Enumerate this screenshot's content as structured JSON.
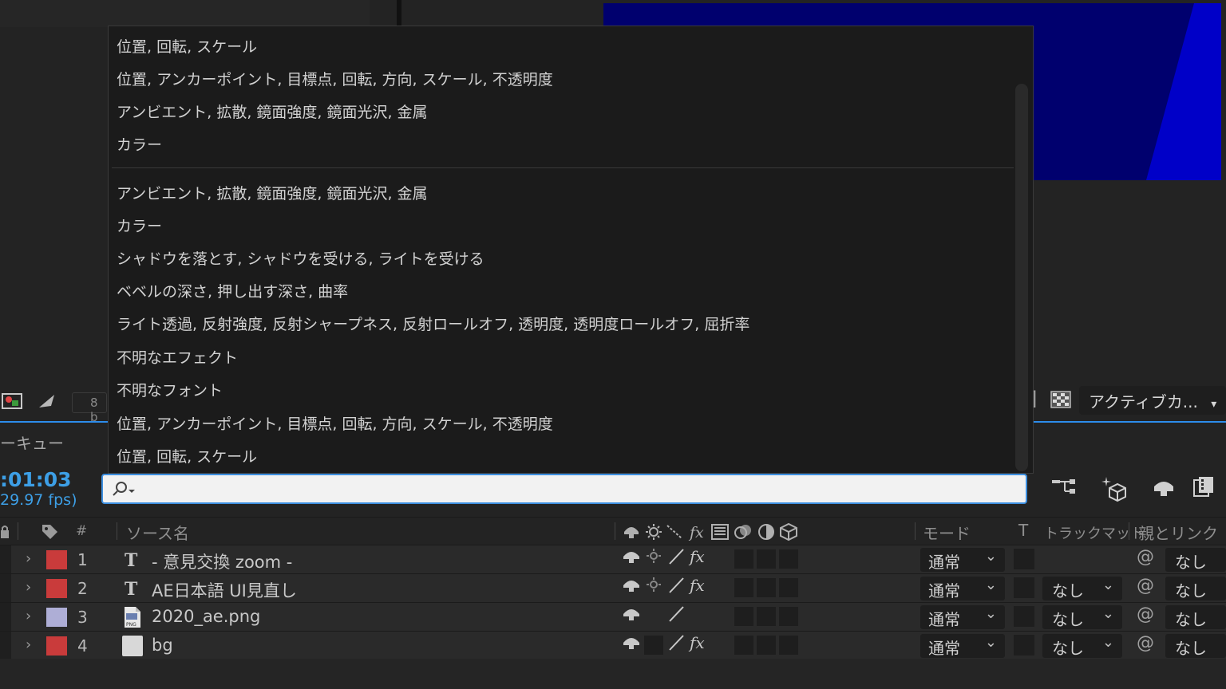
{
  "menu": {
    "items": [
      "位置, 回転, スケール",
      "位置, アンカーポイント, 目標点, 回転, 方向, スケール, 不透明度",
      "アンビエント, 拡散, 鏡面強度, 鏡面光沢, 金属",
      "カラー",
      "アンビエント, 拡散, 鏡面強度, 鏡面光沢, 金属",
      "カラー",
      "シャドウを落とす, シャドウを受ける, ライトを受ける",
      "ベベルの深さ, 押し出す深さ, 曲率",
      "ライト透過, 反射強度, 反射シャープネス, 反射ロールオフ, 透明度, 透明度ロールオフ, 屈折率",
      "不明なエフェクト",
      "不明なフォント",
      "位置, アンカーポイント, 目標点, 回転, 方向, スケール, 不透明度",
      "位置, 回転, スケール"
    ]
  },
  "viewer_toolbar": {
    "bit_depth": "8 b",
    "bracket": "]",
    "camera_label": "アクティブカ...",
    "camera_caret": "▾"
  },
  "timeline": {
    "tab_partial": "ーキュー",
    "timecode": ":01:03",
    "fps": "29.97 fps)",
    "search": {
      "value": "",
      "placeholder": ""
    },
    "headers": {
      "number": "#",
      "source_name": "ソース名",
      "mode": "モード",
      "t": "T",
      "track_matte": "トラックマット",
      "parent": "親とリンク"
    },
    "layers": [
      {
        "num": "1",
        "type": "text",
        "type_glyph": "T",
        "name": "- 意見交換 zoom -",
        "color": "#c93b3b",
        "mode": "通常",
        "matte": "",
        "parent": "なし",
        "has_fx": true,
        "has_quality": true
      },
      {
        "num": "2",
        "type": "text",
        "type_glyph": "T",
        "name": "AE日本語 UI見直し",
        "color": "#c93b3b",
        "mode": "通常",
        "matte": "なし",
        "parent": "なし",
        "has_fx": true,
        "has_quality": true
      },
      {
        "num": "3",
        "type": "png",
        "type_glyph": "PNG",
        "name": "2020_ae.png",
        "color": "#aeaed6",
        "mode": "通常",
        "matte": "なし",
        "parent": "なし",
        "has_fx": false,
        "has_quality": false
      },
      {
        "num": "4",
        "type": "solid",
        "type_glyph": "",
        "name": "bg",
        "color": "#c93b3b",
        "mode": "通常",
        "matte": "なし",
        "parent": "なし",
        "has_fx": true,
        "has_quality": false
      }
    ],
    "glyphs": {
      "chevron": "›",
      "caret": "⌄",
      "fx": "fx",
      "pickwhip": "@"
    }
  },
  "colors": {
    "accent_blue": "#3d9fe6",
    "comp_bg": "#00006e",
    "label_red": "#c93b3b",
    "label_lavender": "#aeaed6"
  }
}
